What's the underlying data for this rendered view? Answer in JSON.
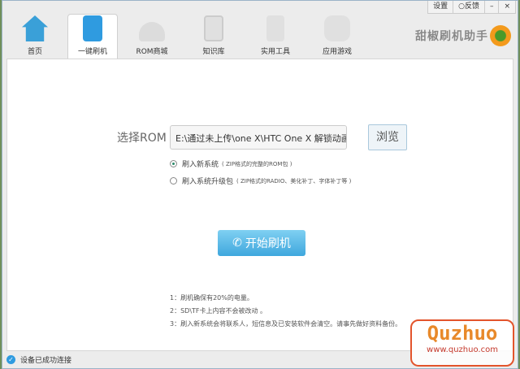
{
  "window_controls": {
    "settings": "设置",
    "feedback": "○反馈",
    "minimize": "–",
    "close": "×"
  },
  "tabs": [
    {
      "label": "首页",
      "color": "#3aa0d8"
    },
    {
      "label": "一键刷机",
      "color": "#2f9be0"
    },
    {
      "label": "ROM商城",
      "color": "#d8d8d8"
    },
    {
      "label": "知识库",
      "color": "#d8d8d8"
    },
    {
      "label": "实用工具",
      "color": "#d8d8d8"
    },
    {
      "label": "应用游戏",
      "color": "#d8d8d8"
    }
  ],
  "brand": "甜椒刷机助手",
  "rom": {
    "label": "选择ROM",
    "path": "E:\\通过未上传\\one X\\HTC One X 解锁动画 文",
    "browse": "浏览"
  },
  "options": [
    {
      "label": "刷入新系统",
      "note": "( ZIP格式的完整的ROM包 )",
      "selected": true
    },
    {
      "label": "刷入系统升级包",
      "note": "( ZIP格式的RADIO、美化补丁、字体补丁等 )",
      "selected": false
    }
  ],
  "start_button": "开始刷机",
  "tips": [
    "1：刷机确保有20%的电量。",
    "2：SD\\TF卡上内容不会被改动 。",
    "3：刷入新系统会将联系人，短信息及已安装软件会清空。请事先做好资料备份。"
  ],
  "status": "设备已成功连接",
  "watermark": {
    "title": "Quzhuo",
    "url": "www.quzhuo.com"
  }
}
